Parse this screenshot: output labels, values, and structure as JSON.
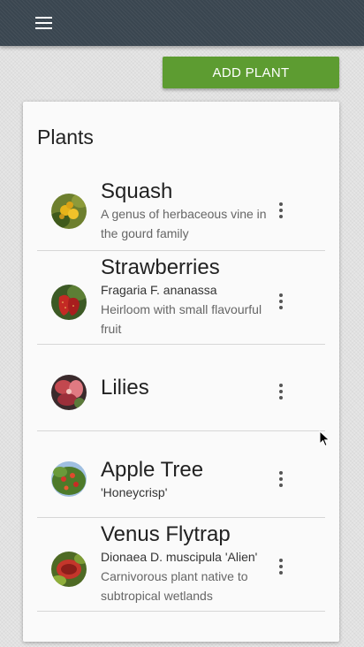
{
  "header": {
    "menu_icon": "hamburger-menu-icon",
    "bar_color": "#3a4650"
  },
  "toolbar": {
    "add_label": "ADD PLANT",
    "accent_color": "#5d9c31"
  },
  "plants_card": {
    "title": "Plants",
    "items": [
      {
        "name": "Squash",
        "scientific": "",
        "description": "A genus of herbaceous vine in the gourd family",
        "photo": "squash-photo"
      },
      {
        "name": "Strawberries",
        "scientific": "Fragaria F. ananassa",
        "description": "Heirloom with small flavourful fruit",
        "photo": "strawberry-photo"
      },
      {
        "name": "Lilies",
        "scientific": "",
        "description": "",
        "photo": "lily-photo"
      },
      {
        "name": "Apple Tree",
        "scientific": "'Honeycrisp'",
        "description": "",
        "photo": "apple-tree-photo"
      },
      {
        "name": "Venus Flytrap",
        "scientific": "Dionaea D. muscipula 'Alien'",
        "description": "Carnivorous plant native to subtropical wetlands",
        "photo": "venus-flytrap-photo"
      }
    ],
    "item_menu_icon": "more-vert-icon"
  }
}
